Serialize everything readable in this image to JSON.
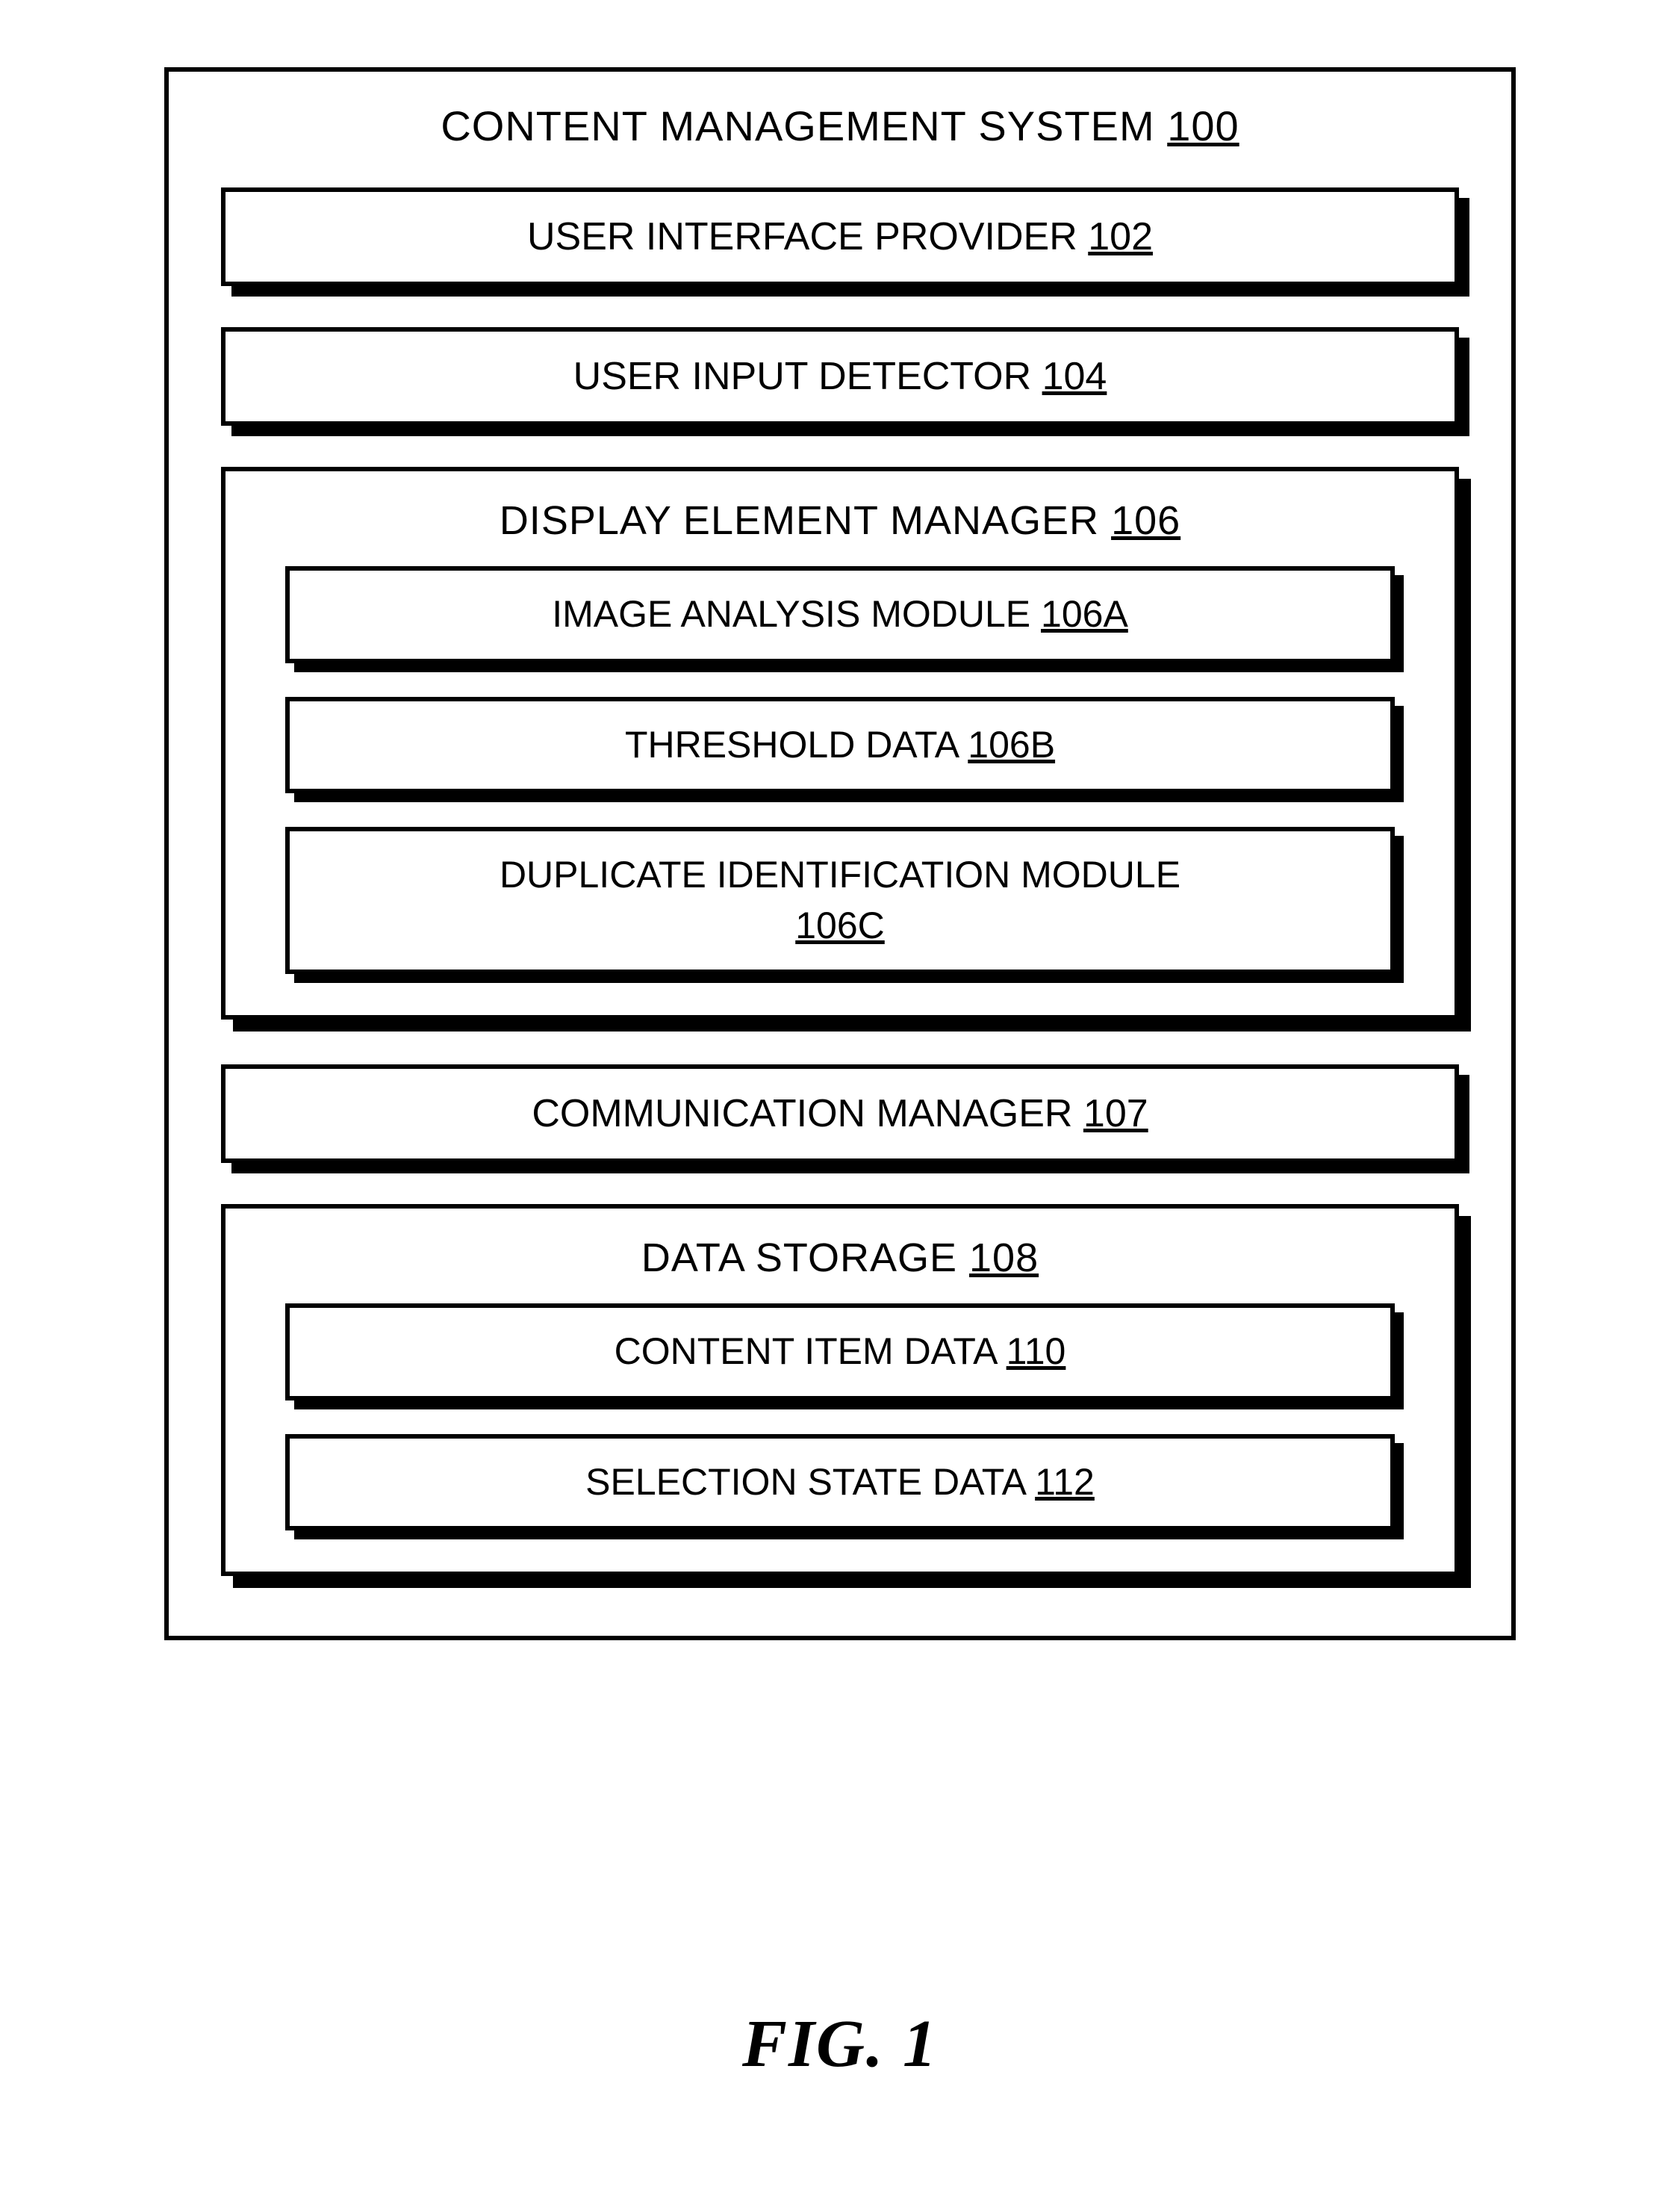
{
  "figureLabel": "FIG. 1",
  "root": {
    "label": "CONTENT MANAGEMENT SYSTEM",
    "ref": "100"
  },
  "boxes": {
    "uiProvider": {
      "label": "USER INTERFACE PROVIDER",
      "ref": "102"
    },
    "inputDetector": {
      "label": "USER INPUT DETECTOR",
      "ref": "104"
    },
    "commManager": {
      "label": "COMMUNICATION MANAGER",
      "ref": "107"
    }
  },
  "displayManager": {
    "label": "DISPLAY ELEMENT MANAGER",
    "ref": "106",
    "children": {
      "imageAnalysis": {
        "label": "IMAGE ANALYSIS MODULE",
        "ref": "106A"
      },
      "threshold": {
        "label": "THRESHOLD DATA",
        "ref": "106B"
      },
      "dupId": {
        "label": "DUPLICATE IDENTIFICATION MODULE",
        "ref": "106C"
      }
    }
  },
  "dataStorage": {
    "label": "DATA STORAGE",
    "ref": "108",
    "children": {
      "contentItem": {
        "label": "CONTENT ITEM DATA",
        "ref": "110"
      },
      "selectionState": {
        "label": "SELECTION STATE DATA",
        "ref": "112"
      }
    }
  }
}
